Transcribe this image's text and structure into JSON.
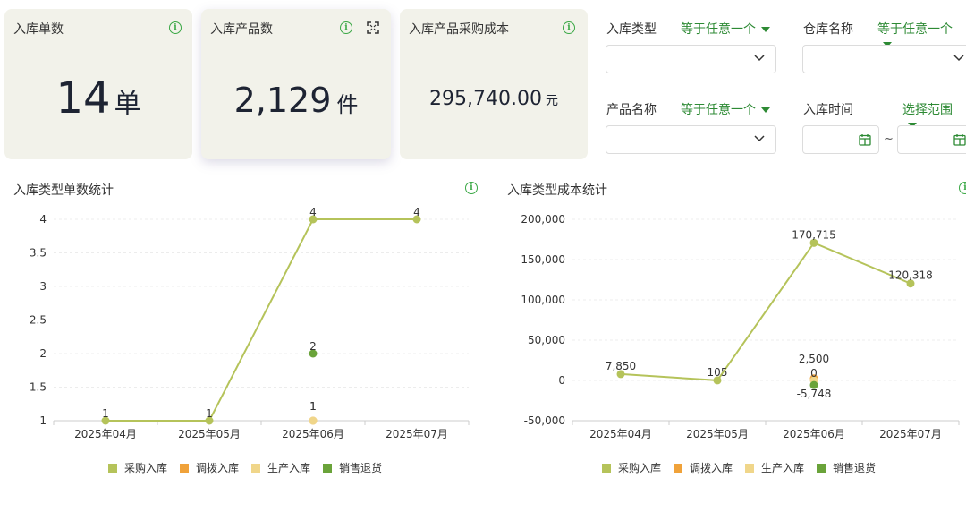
{
  "cards": [
    {
      "title": "入库单数",
      "value": "14",
      "unit": "单"
    },
    {
      "title": "入库产品数",
      "value": "2,129",
      "unit": "件"
    },
    {
      "title": "入库产品采购成本",
      "value": "295,740.00",
      "unit": "元"
    }
  ],
  "filters": {
    "type": {
      "label": "入库类型",
      "op": "等于任意一个"
    },
    "warehouse": {
      "label": "仓库名称",
      "op": "等于任意一个"
    },
    "product": {
      "label": "产品名称",
      "op": "等于任意一个"
    },
    "time": {
      "label": "入库时间",
      "op": "选择范围",
      "sep": "~"
    }
  },
  "colors": {
    "purchase": "#b5c35a",
    "transfer": "#f0a23a",
    "production": "#f0d68a",
    "return": "#6aa33a"
  },
  "legend": [
    "采购入库",
    "调拨入库",
    "生产入库",
    "销售退货"
  ],
  "chart_data": [
    {
      "type": "line",
      "title": "入库类型单数统计",
      "categories": [
        "2025年04月",
        "2025年05月",
        "2025年06月",
        "2025年07月"
      ],
      "ylim": [
        1,
        4
      ],
      "yticks": [
        "1",
        "1.5",
        "2",
        "2.5",
        "3",
        "3.5",
        "4"
      ],
      "series": [
        {
          "name": "采购入库",
          "values": [
            1,
            1,
            4,
            4
          ],
          "labels": [
            "1",
            "1",
            "4",
            "4"
          ]
        },
        {
          "name": "调拨入库",
          "values": [
            null,
            null,
            1,
            null
          ],
          "labels": [
            "",
            "",
            "1",
            ""
          ]
        },
        {
          "name": "生产入库",
          "values": [
            null,
            null,
            1,
            null
          ],
          "labels": [
            "",
            "",
            "1",
            ""
          ]
        },
        {
          "name": "销售退货",
          "values": [
            null,
            null,
            2,
            null
          ],
          "labels": [
            "",
            "",
            "2",
            ""
          ]
        }
      ]
    },
    {
      "type": "line",
      "title": "入库类型成本统计",
      "categories": [
        "2025年04月",
        "2025年05月",
        "2025年06月",
        "2025年07月"
      ],
      "ylim": [
        -50000,
        200000
      ],
      "yticks": [
        "-50,000",
        "0",
        "50,000",
        "100,000",
        "150,000",
        "200,000"
      ],
      "series": [
        {
          "name": "采购入库",
          "values": [
            7850,
            105,
            170715,
            120318
          ],
          "labels": [
            "7,850",
            "105",
            "170,715",
            "120,318"
          ]
        },
        {
          "name": "调拨入库",
          "values": [
            null,
            null,
            2500,
            null
          ],
          "labels": [
            "",
            "",
            "2,500",
            ""
          ]
        },
        {
          "name": "生产入库",
          "values": [
            null,
            null,
            0,
            null
          ],
          "labels": [
            "",
            "",
            "0",
            ""
          ]
        },
        {
          "name": "销售退货",
          "values": [
            null,
            null,
            -5748,
            null
          ],
          "labels": [
            "",
            "",
            "-5,748",
            ""
          ]
        }
      ]
    }
  ]
}
